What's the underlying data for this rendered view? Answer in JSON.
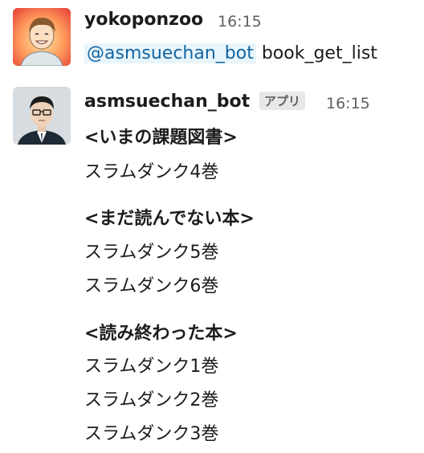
{
  "messages": [
    {
      "user": "yokoponzoo",
      "time": "16:15",
      "mention": "@asmsuechan_bot",
      "text": "book_get_list"
    },
    {
      "user": "asmsuechan_bot",
      "badge": "アプリ",
      "time": "16:15",
      "sections": [
        {
          "heading": "<いまの課題図書>",
          "items": [
            "スラムダンク4巻"
          ]
        },
        {
          "heading": "<まだ読んでない本>",
          "items": [
            "スラムダンク5巻",
            "スラムダンク6巻"
          ]
        },
        {
          "heading": "<読み終わった本>",
          "items": [
            "スラムダンク1巻",
            "スラムダンク2巻",
            "スラムダンク3巻"
          ]
        }
      ]
    }
  ],
  "colors": {
    "mention": "#1264a3",
    "mention_bg": "#e8f5fa",
    "badge_bg": "#e8e8e8",
    "timestamp": "#616061"
  },
  "icons": [
    "yokoponzoo-avatar",
    "asmsuechan-bot-avatar"
  ]
}
